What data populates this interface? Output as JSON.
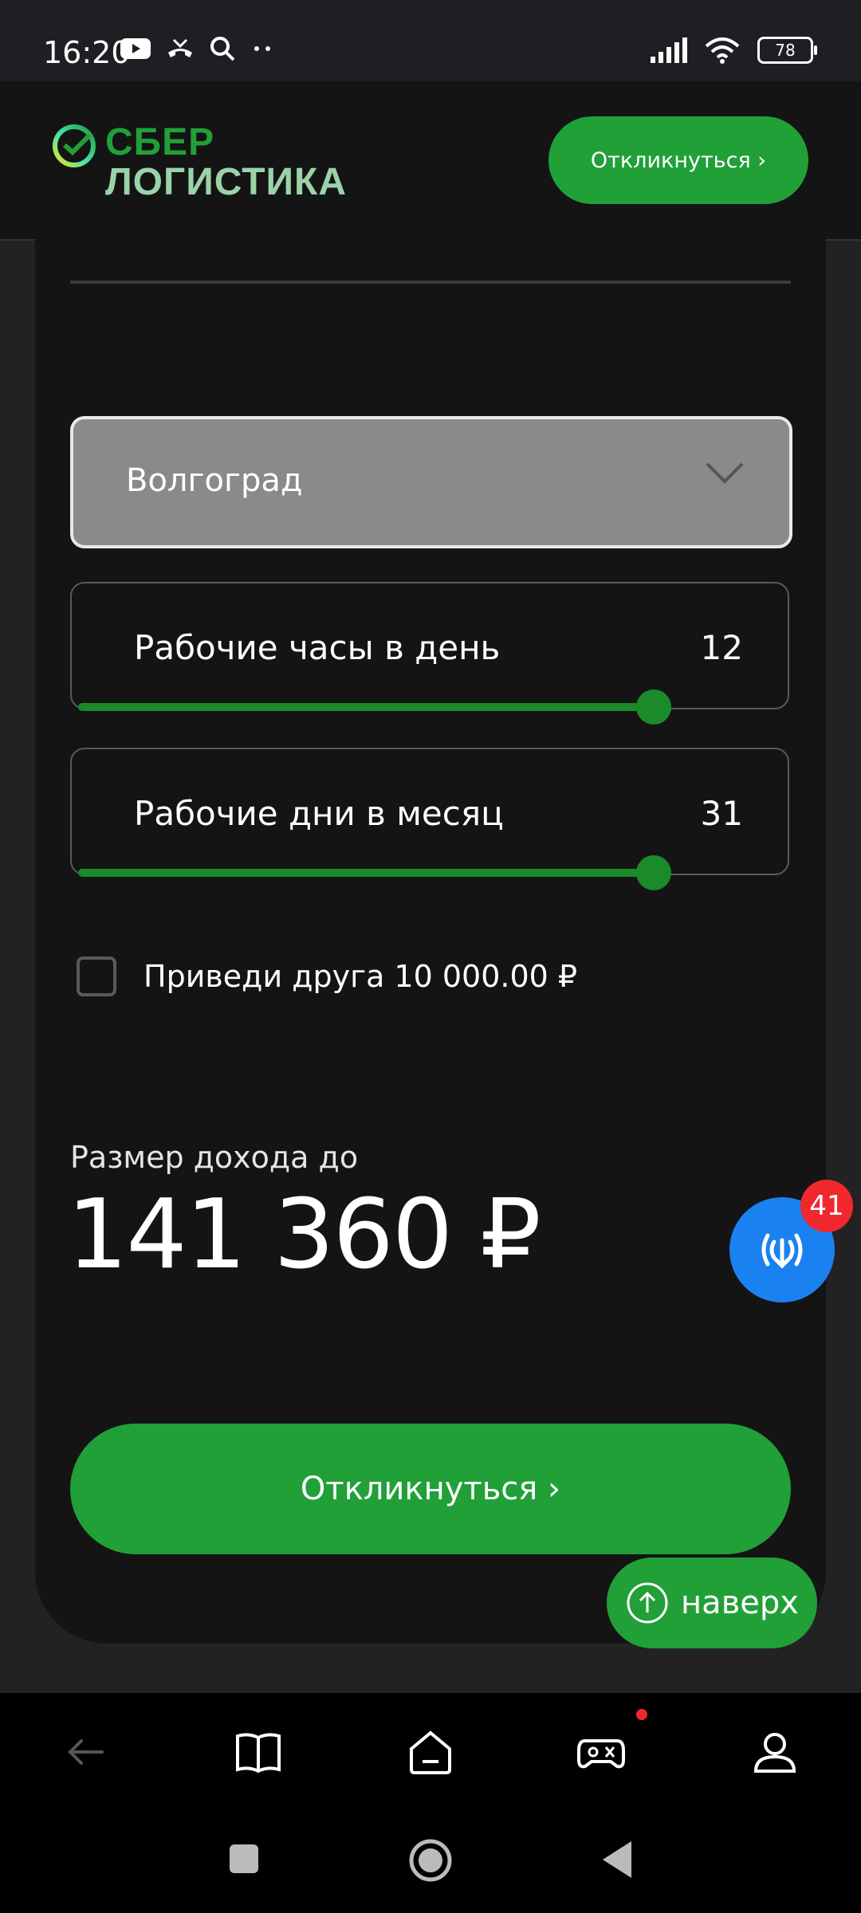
{
  "status_bar": {
    "time": "16:20",
    "battery": "78",
    "left_icons": [
      "youtube-icon",
      "missed-call-icon",
      "search-icon",
      "more-dots-icon"
    ],
    "right_icons": [
      "signal-icon",
      "wifi-icon",
      "battery-icon"
    ]
  },
  "header": {
    "logo_line1": "СБЕР",
    "logo_line2": "ЛОГИСТИКА",
    "cta_label": "Откликнуться ›"
  },
  "calculator": {
    "city": "Волгоград",
    "hours": {
      "label": "Рабочие часы в день",
      "value": "12",
      "fraction": 0.82
    },
    "days": {
      "label": "Рабочие дни в месяц",
      "value": "31",
      "fraction": 0.82
    },
    "referral_label": "Приведи друга 10 000.00 ₽",
    "referral_checked": false,
    "income_label": "Размер дохода до",
    "income_value": "141 360 ₽",
    "cta_label": "Откликнуться ›"
  },
  "floating": {
    "badge_count": "41",
    "top_label": "наверх"
  },
  "colors": {
    "brand_green": "#21a038",
    "slider_green": "#1a8a2a",
    "fab_blue": "#1a82f0",
    "badge_red": "#f0282d"
  },
  "bottom_nav": [
    "back-icon",
    "book-icon",
    "home-icon",
    "gamepad-icon",
    "profile-icon"
  ],
  "system_nav": [
    "recent-apps-icon",
    "home-circle-icon",
    "back-triangle-icon"
  ]
}
